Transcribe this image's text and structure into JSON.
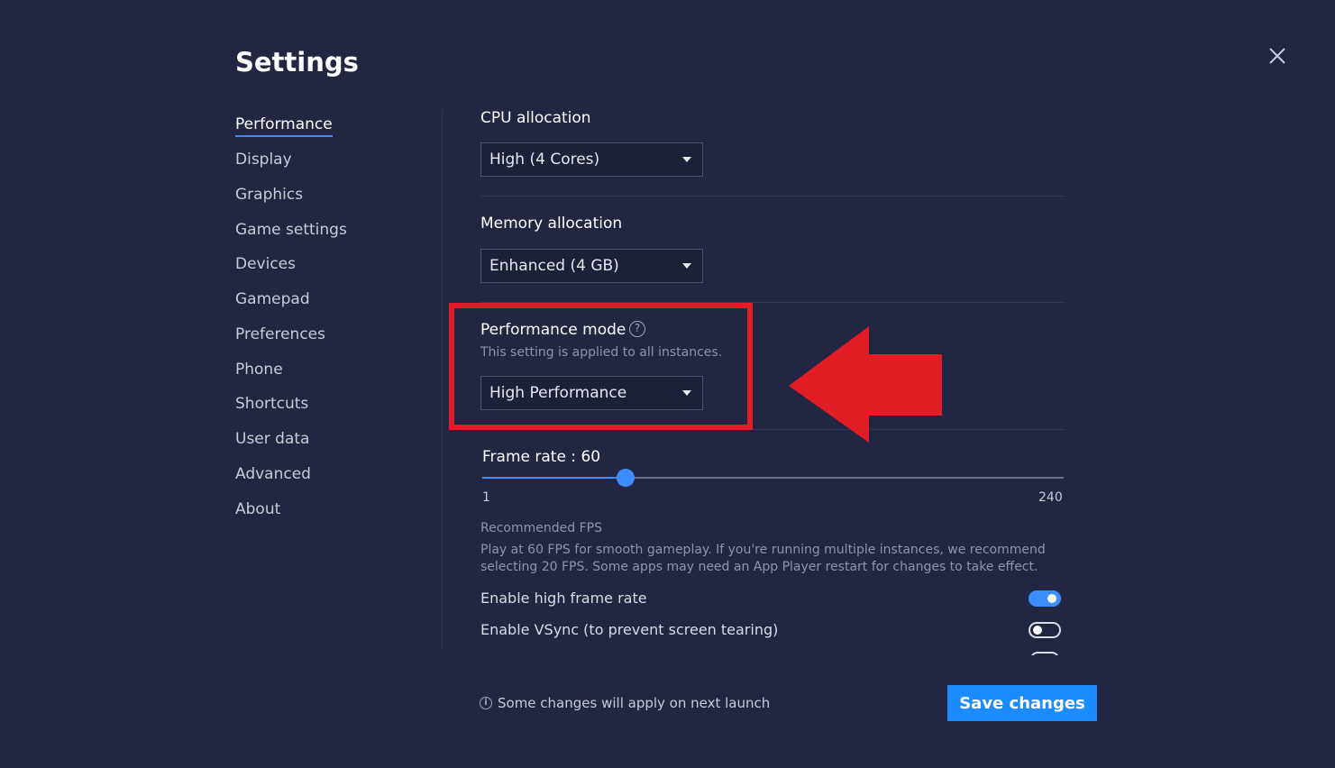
{
  "title": "Settings",
  "nav": {
    "items": [
      {
        "label": "Performance",
        "active": true
      },
      {
        "label": "Display"
      },
      {
        "label": "Graphics"
      },
      {
        "label": "Game settings"
      },
      {
        "label": "Devices"
      },
      {
        "label": "Gamepad"
      },
      {
        "label": "Preferences"
      },
      {
        "label": "Phone"
      },
      {
        "label": "Shortcuts"
      },
      {
        "label": "User data"
      },
      {
        "label": "Advanced"
      },
      {
        "label": "About"
      }
    ]
  },
  "cpu": {
    "label": "CPU allocation",
    "value": "High (4 Cores)"
  },
  "memory": {
    "label": "Memory allocation",
    "value": "Enhanced (4 GB)"
  },
  "performance_mode": {
    "label": "Performance mode",
    "help_glyph": "?",
    "subtitle": "This setting is applied to all instances.",
    "value": "High Performance"
  },
  "frame_rate": {
    "label": "Frame rate : 60",
    "value": 60,
    "min": 1,
    "max": 240,
    "min_label": "1",
    "max_label": "240",
    "recommended_title": "Recommended FPS",
    "recommended_text": "Play at 60 FPS for smooth gameplay. If you're running multiple instances, we recommend selecting 20 FPS. Some apps may need an App Player restart for changes to take effect."
  },
  "toggles": {
    "high_frame_rate": {
      "label": "Enable high frame rate",
      "on": true
    },
    "vsync": {
      "label": "Enable VSync (to prevent screen tearing)",
      "on": false
    }
  },
  "footer": {
    "info_glyph": "i",
    "note": "Some changes will apply on next launch",
    "save_label": "Save changes"
  },
  "colors": {
    "background": "#222643",
    "accent": "#1a8cff",
    "highlight_annotation": "#e31d25"
  },
  "icons": [
    "close-icon",
    "help-icon",
    "info-icon",
    "red-arrow-annotation"
  ]
}
